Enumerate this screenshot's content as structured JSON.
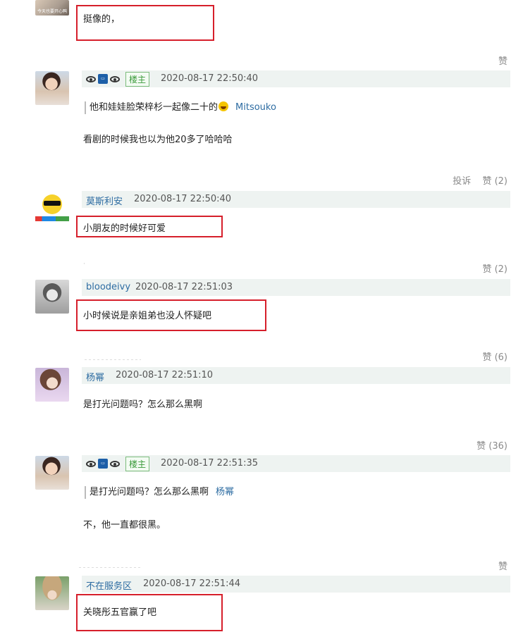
{
  "comments": [
    {
      "avatar_caption": "今天也要开心鸭",
      "text": "挺像的，",
      "actions": [
        "赞"
      ]
    },
    {
      "owner_badge": "楼主",
      "time": "2020-08-17 22:50:40",
      "quote_text": "他和娃娃脸荣梓杉一起像二十的",
      "quote_name": "Mitsouko",
      "text": "看剧的时候我也以为他20多了哈哈哈",
      "actions": [
        "投诉",
        "赞 (2)"
      ]
    },
    {
      "name": "莫斯利安",
      "time": "2020-08-17 22:50:40",
      "text": "小朋友的时候好可爱",
      "actions": [
        "赞 (2)"
      ]
    },
    {
      "name": "bloodeivy",
      "time": "2020-08-17 22:51:03",
      "text": "小时候说是亲姐弟也没人怀疑吧",
      "actions": [
        "赞 (6)"
      ]
    },
    {
      "name": "杨幂",
      "time": "2020-08-17 22:51:10",
      "text": "是打光问题吗？怎么那么黑啊",
      "actions": [
        "赞 (36)"
      ]
    },
    {
      "owner_badge": "楼主",
      "time": "2020-08-17 22:51:35",
      "quote_text": "是打光问题吗？怎么那么黑啊",
      "quote_name": "杨幂",
      "text": "不，他一直都很黑。",
      "actions": [
        "赞"
      ]
    },
    {
      "name": "不在服务区",
      "time": "2020-08-17 22:51:44",
      "text": "关晓彤五官赢了吧"
    }
  ],
  "icons": {
    "eye": "eye-icon",
    "id_card": "id-card-icon",
    "laugh_emoji": "laughing-emoji-icon"
  },
  "colors": {
    "username": "#2d6ca2",
    "header_bg": "#eef3f1",
    "highlight_box": "#d61f2b",
    "owner_badge": "#3a9a3a",
    "action_text": "#8a8a8a"
  }
}
